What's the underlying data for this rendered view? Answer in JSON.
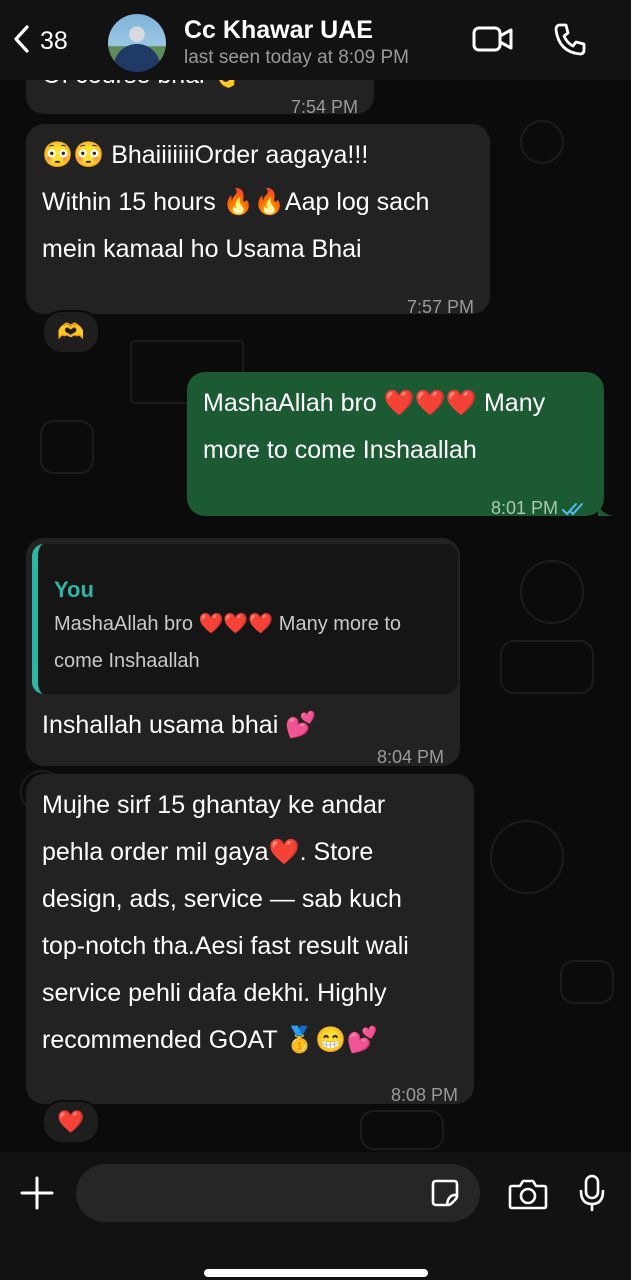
{
  "header": {
    "back_count": "38",
    "contact_name": "Cc Khawar UAE",
    "last_seen": "last seen today at 8:09 PM",
    "icons": [
      "back-chevron-icon",
      "video-call-icon",
      "voice-call-icon"
    ]
  },
  "messages": [
    {
      "dir": "in",
      "text": "Of course bhai 👌",
      "time": "7:54 PM"
    },
    {
      "dir": "in",
      "lines": [
        "😳😳 BhaiiiiiiiOrder aagaya!!!",
        "Within 15 hours 🔥🔥Aap log sach",
        "mein kamaal ho Usama Bhai"
      ],
      "time": "7:57 PM",
      "reaction": "🫶"
    },
    {
      "dir": "out",
      "lines": [
        "MashaAllah bro ❤️❤️❤️ Many",
        "more to come Inshaallah"
      ],
      "time": "8:01 PM",
      "status": "read"
    },
    {
      "dir": "in",
      "quote_author": "You",
      "quote_lines": [
        "MashaAllah bro ❤️❤️❤️ Many more to",
        "come Inshaallah"
      ],
      "text": "Inshallah usama bhai 💕",
      "time": "8:04 PM"
    },
    {
      "dir": "in",
      "lines": [
        "Mujhe sirf 15 ghantay ke andar",
        "pehla order mil gaya❤️. Store",
        "design, ads, service — sab kuch",
        "top-notch tha.Aesi fast result wali",
        "service pehli dafa dekhi. Highly",
        "recommended GOAT 🥇😁💕"
      ],
      "time": "8:08 PM",
      "reaction": "❤️"
    }
  ],
  "composer": {
    "icons": [
      "plus-icon",
      "sticker-icon",
      "camera-icon",
      "microphone-icon"
    ]
  },
  "colors": {
    "incoming_bubble": "#222222",
    "outgoing_bubble": "#1b5a33",
    "quote_accent": "#2fb5a3",
    "read_ticks": "#53bdeb"
  }
}
